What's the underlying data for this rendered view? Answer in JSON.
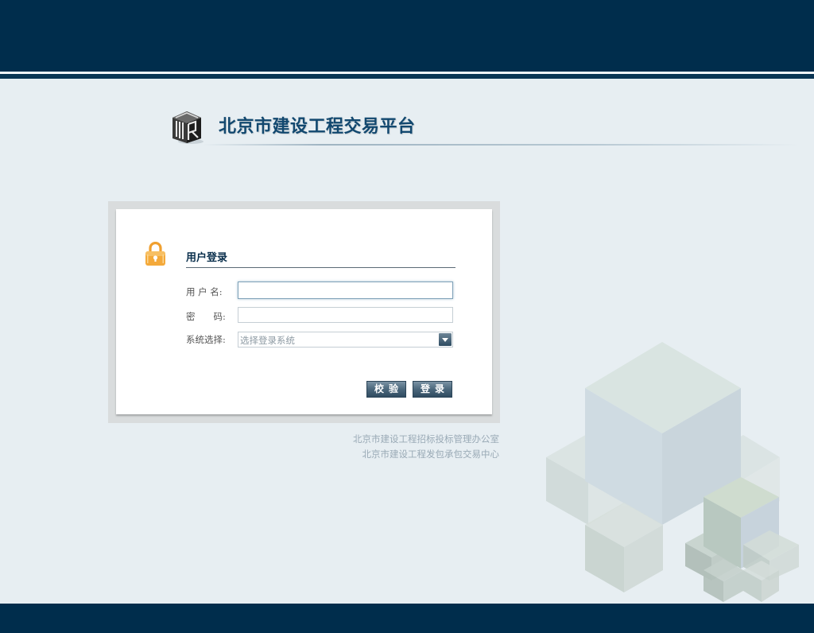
{
  "header": {
    "site_title": "北京市建设工程交易平台"
  },
  "login": {
    "heading": "用户登录",
    "username_label": "用 户 名:",
    "username_value": "",
    "password_label": "密　　码:",
    "password_value": "",
    "system_label": "系统选择:",
    "system_placeholder": "选择登录系统",
    "verify_button": "校验",
    "login_button": "登录"
  },
  "footer": {
    "line1": "北京市建设工程招标投标管理办公室",
    "line2": "北京市建设工程发包承包交易中心"
  },
  "colors": {
    "header_bar": "#002d4c",
    "background": "#e7eef2",
    "title": "#12486f",
    "button": "#4b677c",
    "lock": "#f0a030"
  }
}
